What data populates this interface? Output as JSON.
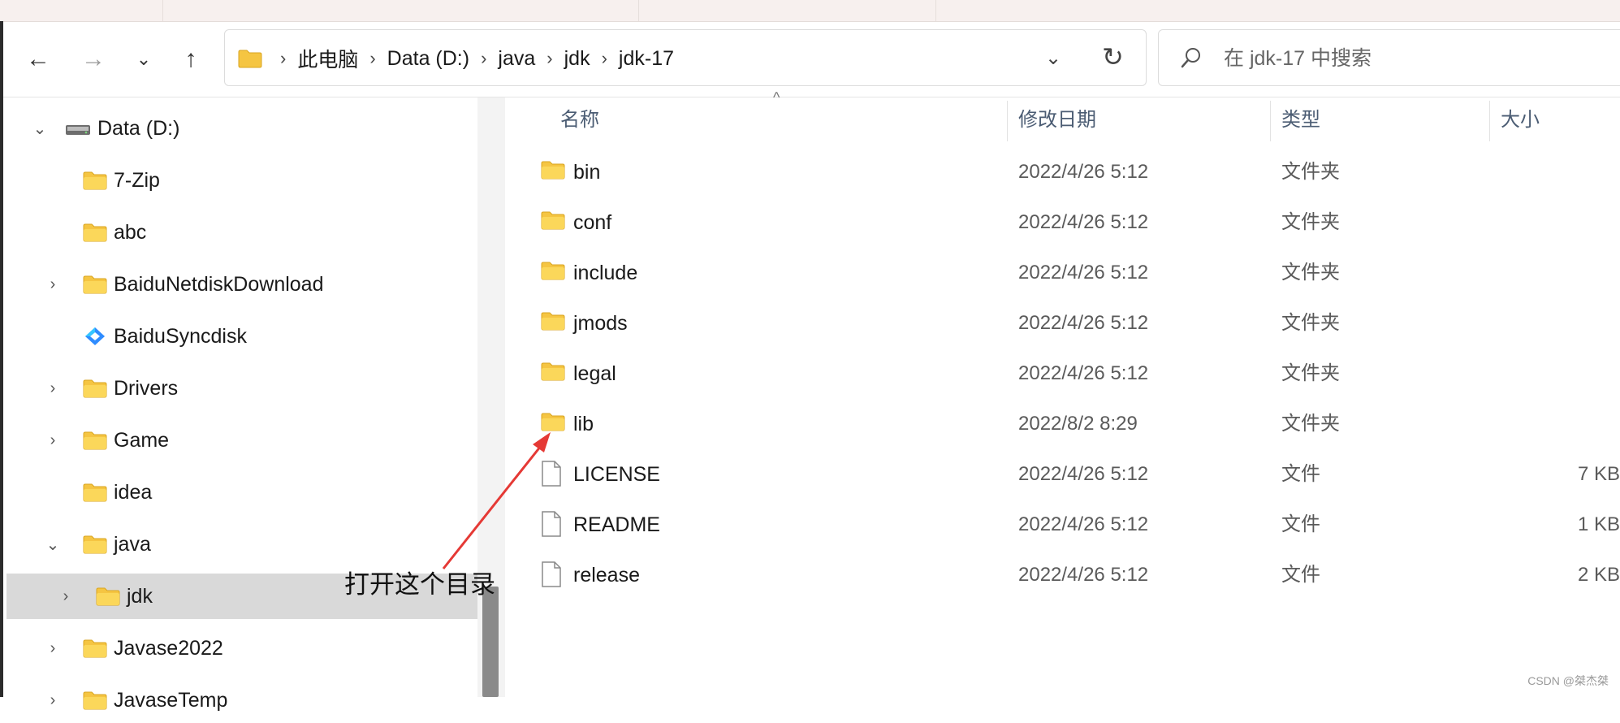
{
  "window": {
    "back_label": "←",
    "forward_label": "→",
    "recent_label": "⌄",
    "up_label": "↑"
  },
  "address": {
    "crumbs": [
      "此电脑",
      "Data (D:)",
      "java",
      "jdk",
      "jdk-17"
    ],
    "dropdown": "⌄",
    "refresh": "↻"
  },
  "search": {
    "placeholder": "在 jdk-17 中搜索"
  },
  "tree": {
    "items": [
      {
        "label": "Data (D:)",
        "chevron": "⌄",
        "icon": "drive-icon"
      },
      {
        "label": "7-Zip",
        "chevron": "",
        "icon": "folder-icon"
      },
      {
        "label": "abc",
        "chevron": "",
        "icon": "folder-icon"
      },
      {
        "label": "BaiduNetdiskDownload",
        "chevron": "›",
        "icon": "folder-icon"
      },
      {
        "label": "BaiduSyncdisk",
        "chevron": "",
        "icon": "baidu-sync-icon"
      },
      {
        "label": "Drivers",
        "chevron": "›",
        "icon": "folder-icon"
      },
      {
        "label": "Game",
        "chevron": "›",
        "icon": "folder-icon"
      },
      {
        "label": "idea",
        "chevron": "",
        "icon": "folder-icon"
      },
      {
        "label": "java",
        "chevron": "⌄",
        "icon": "folder-icon"
      },
      {
        "label": "jdk",
        "chevron": "›",
        "icon": "folder-icon"
      },
      {
        "label": "Javase2022",
        "chevron": "›",
        "icon": "folder-icon"
      },
      {
        "label": "JavaseTemp",
        "chevron": "›",
        "icon": "folder-icon"
      }
    ]
  },
  "columns": {
    "name": "名称",
    "date": "修改日期",
    "type": "类型",
    "size": "大小"
  },
  "files": [
    {
      "name": "bin",
      "date": "2022/4/26 5:12",
      "type": "文件夹",
      "size": "",
      "icon": "folder-icon"
    },
    {
      "name": "conf",
      "date": "2022/4/26 5:12",
      "type": "文件夹",
      "size": "",
      "icon": "folder-icon"
    },
    {
      "name": "include",
      "date": "2022/4/26 5:12",
      "type": "文件夹",
      "size": "",
      "icon": "folder-icon"
    },
    {
      "name": "jmods",
      "date": "2022/4/26 5:12",
      "type": "文件夹",
      "size": "",
      "icon": "folder-icon"
    },
    {
      "name": "legal",
      "date": "2022/4/26 5:12",
      "type": "文件夹",
      "size": "",
      "icon": "folder-icon"
    },
    {
      "name": "lib",
      "date": "2022/8/2 8:29",
      "type": "文件夹",
      "size": "",
      "icon": "folder-icon"
    },
    {
      "name": "LICENSE",
      "date": "2022/4/26 5:12",
      "type": "文件",
      "size": "7 KB",
      "icon": "file-icon"
    },
    {
      "name": "README",
      "date": "2022/4/26 5:12",
      "type": "文件",
      "size": "1 KB",
      "icon": "file-icon"
    },
    {
      "name": "release",
      "date": "2022/4/26 5:12",
      "type": "文件",
      "size": "2 KB",
      "icon": "file-icon"
    }
  ],
  "annotation": {
    "text": "打开这个目录"
  },
  "watermark": "CSDN @桀杰桀",
  "colors": {
    "folder": "#f5c542",
    "selected_row": "#d9d9d9",
    "arrow": "#e53935"
  }
}
